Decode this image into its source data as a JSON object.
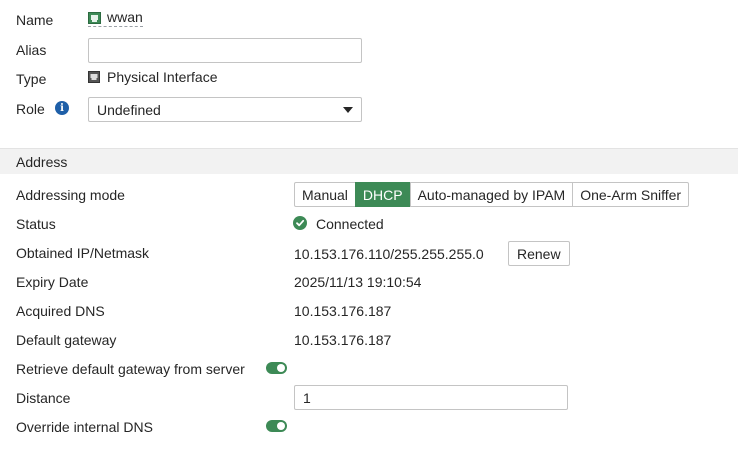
{
  "general": {
    "name_label": "Name",
    "name_value": "wwan",
    "alias_label": "Alias",
    "alias_value": "",
    "type_label": "Type",
    "type_value": "Physical Interface",
    "role_label": "Role",
    "role_value": "Undefined"
  },
  "address": {
    "section_title": "Address",
    "addressing_mode_label": "Addressing mode",
    "modes": [
      "Manual",
      "DHCP",
      "Auto-managed by IPAM",
      "One-Arm Sniffer"
    ],
    "selected_mode": "DHCP",
    "status_label": "Status",
    "status_value": "Connected",
    "ip_label": "Obtained IP/Netmask",
    "ip_value": "10.153.176.110/255.255.255.0",
    "renew_label": "Renew",
    "expiry_label": "Expiry Date",
    "expiry_value": "2025/11/13 19:10:54",
    "dns_label": "Acquired DNS",
    "dns_value": "10.153.176.187",
    "gateway_label": "Default gateway",
    "gateway_value": "10.153.176.187",
    "retrieve_gateway_label": "Retrieve default gateway from server",
    "retrieve_gateway_enabled": true,
    "distance_label": "Distance",
    "distance_value": "1",
    "override_dns_label": "Override internal DNS",
    "override_dns_enabled": true
  },
  "colors": {
    "accent_green": "#3d8a56",
    "info_blue": "#1e5fa8",
    "section_bg": "#f2f2f2"
  },
  "icons": {
    "name": "network-port-icon",
    "type": "network-port-icon",
    "role_info": "info-icon",
    "status": "check-circle-icon"
  }
}
